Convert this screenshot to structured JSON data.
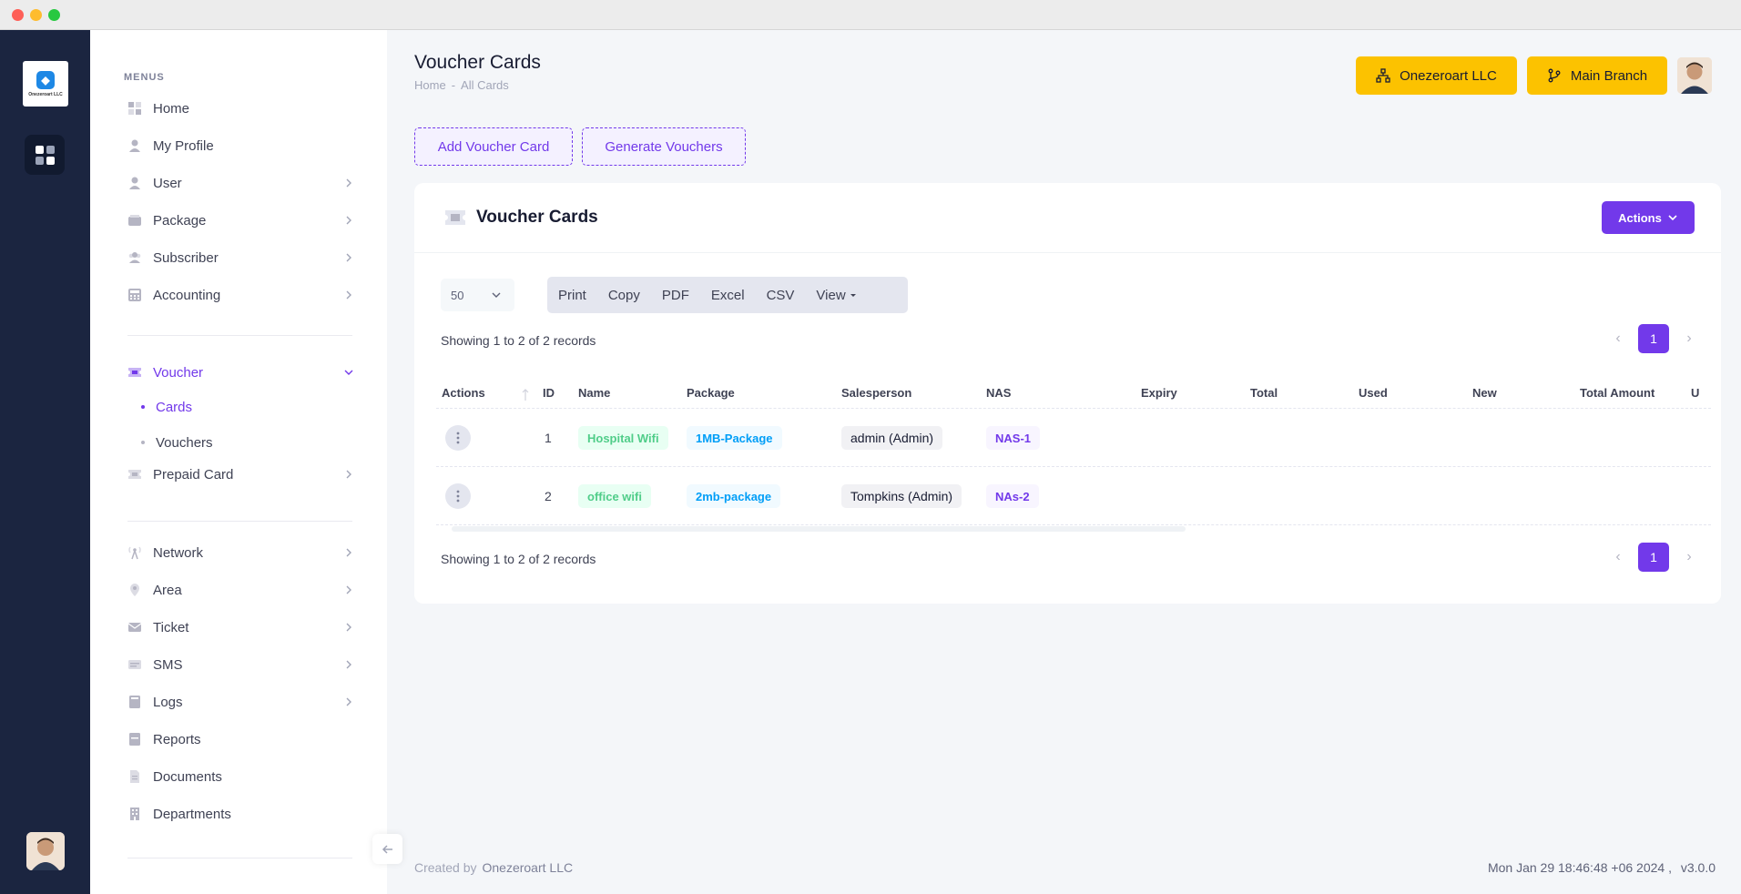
{
  "app": {
    "logo_text": "Onezeroart LLC"
  },
  "sidebar": {
    "menus_title": "MENUS",
    "items": [
      {
        "label": "Home"
      },
      {
        "label": "My Profile"
      },
      {
        "label": "User"
      },
      {
        "label": "Package"
      },
      {
        "label": "Subscriber"
      },
      {
        "label": "Accounting"
      },
      {
        "label": "Voucher"
      },
      {
        "label": "Prepaid Card"
      },
      {
        "label": "Network"
      },
      {
        "label": "Area"
      },
      {
        "label": "Ticket"
      },
      {
        "label": "SMS"
      },
      {
        "label": "Logs"
      },
      {
        "label": "Reports"
      },
      {
        "label": "Documents"
      },
      {
        "label": "Departments"
      }
    ],
    "voucher_sub": [
      {
        "label": "Cards"
      },
      {
        "label": "Vouchers"
      }
    ]
  },
  "header": {
    "title": "Voucher Cards",
    "breadcrumb": [
      "Home",
      "-",
      "All Cards"
    ],
    "company_button": "Onezeroart LLC",
    "branch_button": "Main Branch"
  },
  "toolbar": {
    "add_label": "Add Voucher Card",
    "generate_label": "Generate Vouchers"
  },
  "card": {
    "title": "Voucher Cards",
    "actions_label": "Actions",
    "page_length": "50",
    "exports": [
      "Print",
      "Copy",
      "PDF",
      "Excel",
      "CSV",
      "View"
    ],
    "info": "Showing 1 to 2 of 2 records",
    "current_page": "1"
  },
  "table": {
    "columns": [
      "Actions",
      "ID",
      "Name",
      "Package",
      "Salesperson",
      "NAS",
      "Expiry",
      "Total",
      "Used",
      "New",
      "Total Amount",
      "U"
    ],
    "rows": [
      {
        "id": "1",
        "name": "Hospital Wifi",
        "package": "1MB-Package",
        "salesperson": "admin (Admin)",
        "nas": "NAS-1"
      },
      {
        "id": "2",
        "name": "office wifi",
        "package": "2mb-package",
        "salesperson": "Tompkins (Admin)",
        "nas": "NAs-2"
      }
    ]
  },
  "footer": {
    "created_by": "Created by",
    "brand": "Onezeroart LLC",
    "datetime": "Mon Jan 29 18:46:48 +06 2024 ,",
    "version": "v3.0.0"
  },
  "colors": {
    "accent": "#7239ea",
    "yellow": "#fcc200",
    "rail": "#1b2540"
  }
}
